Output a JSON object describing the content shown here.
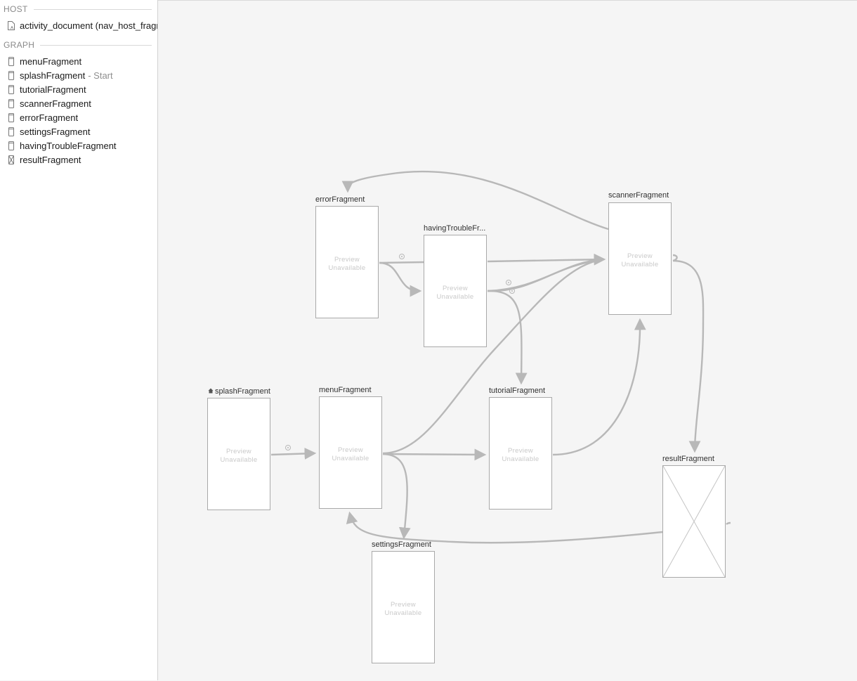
{
  "host": {
    "header": "HOST",
    "item": {
      "label": "activity_document (nav_host_fragment)",
      "icon": "layout-file-icon"
    }
  },
  "graph": {
    "header": "GRAPH",
    "items": [
      {
        "label": "menuFragment",
        "icon": "fragment-icon"
      },
      {
        "label": "splashFragment",
        "suffix": "- Start",
        "icon": "fragment-icon"
      },
      {
        "label": "tutorialFragment",
        "icon": "fragment-icon"
      },
      {
        "label": "scannerFragment",
        "icon": "fragment-icon"
      },
      {
        "label": "errorFragment",
        "icon": "fragment-icon"
      },
      {
        "label": "settingsFragment",
        "icon": "fragment-icon"
      },
      {
        "label": "havingTroubleFragment",
        "icon": "fragment-icon"
      },
      {
        "label": "resultFragment",
        "icon": "fragment-no-layout-icon"
      }
    ]
  },
  "nodes": {
    "errorFragment": {
      "title": "errorFragment",
      "preview": [
        "Preview",
        "Unavailable"
      ]
    },
    "havingTroubleFragment": {
      "title": "havingTroubleFr...",
      "preview": [
        "Preview",
        "Unavailable"
      ]
    },
    "scannerFragment": {
      "title": "scannerFragment",
      "preview": [
        "Preview",
        "Unavailable"
      ]
    },
    "splashFragment": {
      "title": "splashFragment",
      "start_icon": "home-icon",
      "preview": [
        "Preview",
        "Unavailable"
      ]
    },
    "menuFragment": {
      "title": "menuFragment",
      "preview": [
        "Preview",
        "Unavailable"
      ]
    },
    "tutorialFragment": {
      "title": "tutorialFragment",
      "preview": [
        "Preview",
        "Unavailable"
      ]
    },
    "resultFragment": {
      "title": "resultFragment",
      "preview": []
    },
    "settingsFragment": {
      "title": "settingsFragment",
      "preview": [
        "Preview",
        "Unavailable"
      ]
    }
  },
  "colors": {
    "canvas": "#f5f5f5",
    "sidebar": "#ffffff",
    "edge": "#b8b8b8",
    "node_border": "#a9a9a9",
    "preview_text": "#c9c9c9"
  }
}
